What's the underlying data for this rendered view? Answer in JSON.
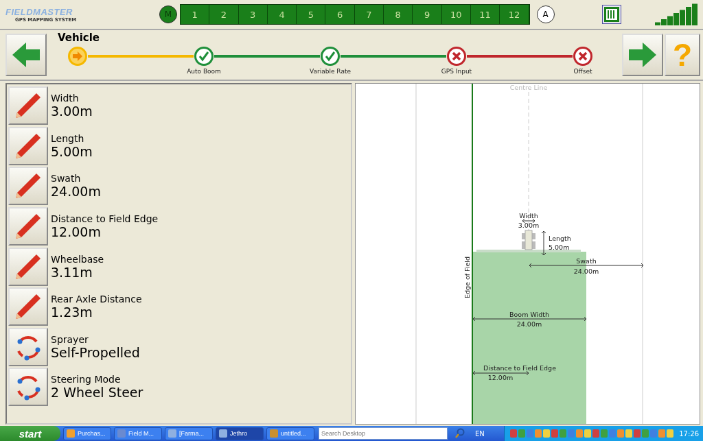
{
  "logo": {
    "name": "**FIELD**MASTER",
    "tagline": "GPS MAPPING SYSTEM"
  },
  "sections": {
    "master": "M",
    "auto": "A",
    "cells": [
      "1",
      "2",
      "3",
      "4",
      "5",
      "6",
      "7",
      "8",
      "9",
      "10",
      "11",
      "12"
    ]
  },
  "wizard": {
    "title": "Vehicle",
    "help": "?",
    "steps": [
      {
        "kind": "current"
      },
      {
        "label": "Auto Boom",
        "kind": "done"
      },
      {
        "label": "Variable Rate",
        "kind": "done"
      },
      {
        "label": "GPS Input",
        "kind": "error"
      },
      {
        "label": "Offset",
        "kind": "error"
      }
    ]
  },
  "settings": [
    {
      "kind": "edit",
      "label": "Width",
      "value": "3.00m"
    },
    {
      "kind": "edit",
      "label": "Length",
      "value": "5.00m"
    },
    {
      "kind": "edit",
      "label": "Swath",
      "value": "24.00m"
    },
    {
      "kind": "edit",
      "label": "Distance to Field Edge",
      "value": "12.00m"
    },
    {
      "kind": "edit",
      "label": "Wheelbase",
      "value": "3.11m"
    },
    {
      "kind": "edit",
      "label": "Rear Axle Distance",
      "value": "1.23m"
    },
    {
      "kind": "cycle",
      "label": "Sprayer",
      "value": "Self-Propelled"
    },
    {
      "kind": "cycle",
      "label": "Steering Mode",
      "value": "2 Wheel Steer"
    }
  ],
  "diagram": {
    "centre_line": "Centre Line",
    "width_label": "Width",
    "width_value": "3.00m",
    "length_label": "Length",
    "length_value": "5.00m",
    "swath_label": "Swath",
    "swath_value": "24.00m",
    "edge_label": "Edge of Field",
    "boom_label": "Boom Width",
    "boom_value": "24.00m",
    "distance_label": "Distance to Field Edge",
    "distance_value": "12.00m"
  },
  "taskbar": {
    "start": "start",
    "tasks": [
      {
        "label": "Purchas...",
        "selected": false
      },
      {
        "label": "Field M...",
        "selected": false
      },
      {
        "label": "[Farma...",
        "selected": false
      },
      {
        "label": "Jethro",
        "selected": true
      },
      {
        "label": "untitled...",
        "selected": false
      }
    ],
    "search_placeholder": "Search Desktop",
    "language": "EN",
    "clock": "17:26"
  }
}
